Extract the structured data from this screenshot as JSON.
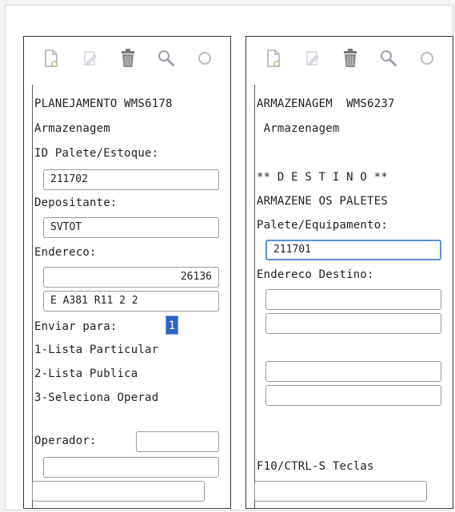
{
  "icons": {
    "toolbar": [
      "new-document-icon",
      "edit-icon",
      "trash-icon",
      "search-icon",
      "refresh-icon"
    ]
  },
  "colors": {
    "accent": "#2c63c8",
    "focus_border": "#5b8fd6"
  },
  "left_panel": {
    "header": "PLANEJAMENTO WMS6178",
    "subtitle": "Armazenagem",
    "pallet_label": "ID Palete/Estoque:",
    "pallet_value": "211702",
    "depositor_label": "Depositante:",
    "depositor_value": "SVTOT",
    "address_label": "Endereco:",
    "address_value_1": "26136",
    "address_value_2": "E A381 R11 2 2",
    "send_to_label": "Enviar para:",
    "send_to_value": "1",
    "option_1": "1-Lista Particular",
    "option_2": "2-Lista Publica",
    "option_3": "3-Seleciona Operad",
    "operator_label": "Operador:",
    "operator_value": "",
    "extra_value": "",
    "command_value": ""
  },
  "right_panel": {
    "header": "ARMAZENAGEM  WMS6237",
    "subtitle": " Armazenagem",
    "destination_title": "** D E S T I N O **",
    "instruction": "ARMAZENE OS PALETES",
    "pallet_label": "Palete/Equipamento:",
    "pallet_value": "211701",
    "dest_address_label": "Endereco Destino:",
    "dest_1": "",
    "dest_2": "",
    "dest_3": "",
    "dest_4": "",
    "keys_hint": "F10/CTRL-S Teclas",
    "command_value": ""
  }
}
